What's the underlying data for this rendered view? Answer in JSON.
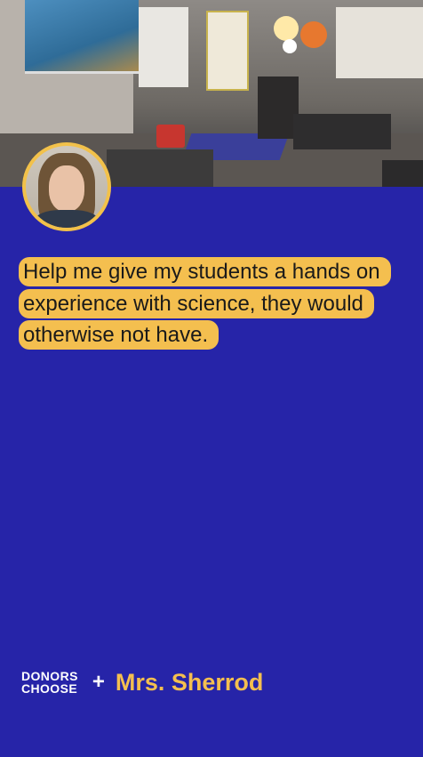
{
  "quote": {
    "text": "Help me give my students a hands on experience with science, they would otherwise not have."
  },
  "footer": {
    "logo_line1": "DONORS",
    "logo_line2": "CHOOSE",
    "plus": "+",
    "teacher_name": "Mrs. Sherrod"
  },
  "colors": {
    "background": "#2624a8",
    "highlight": "#f4bf4f",
    "accent_text": "#f4bf4f"
  }
}
